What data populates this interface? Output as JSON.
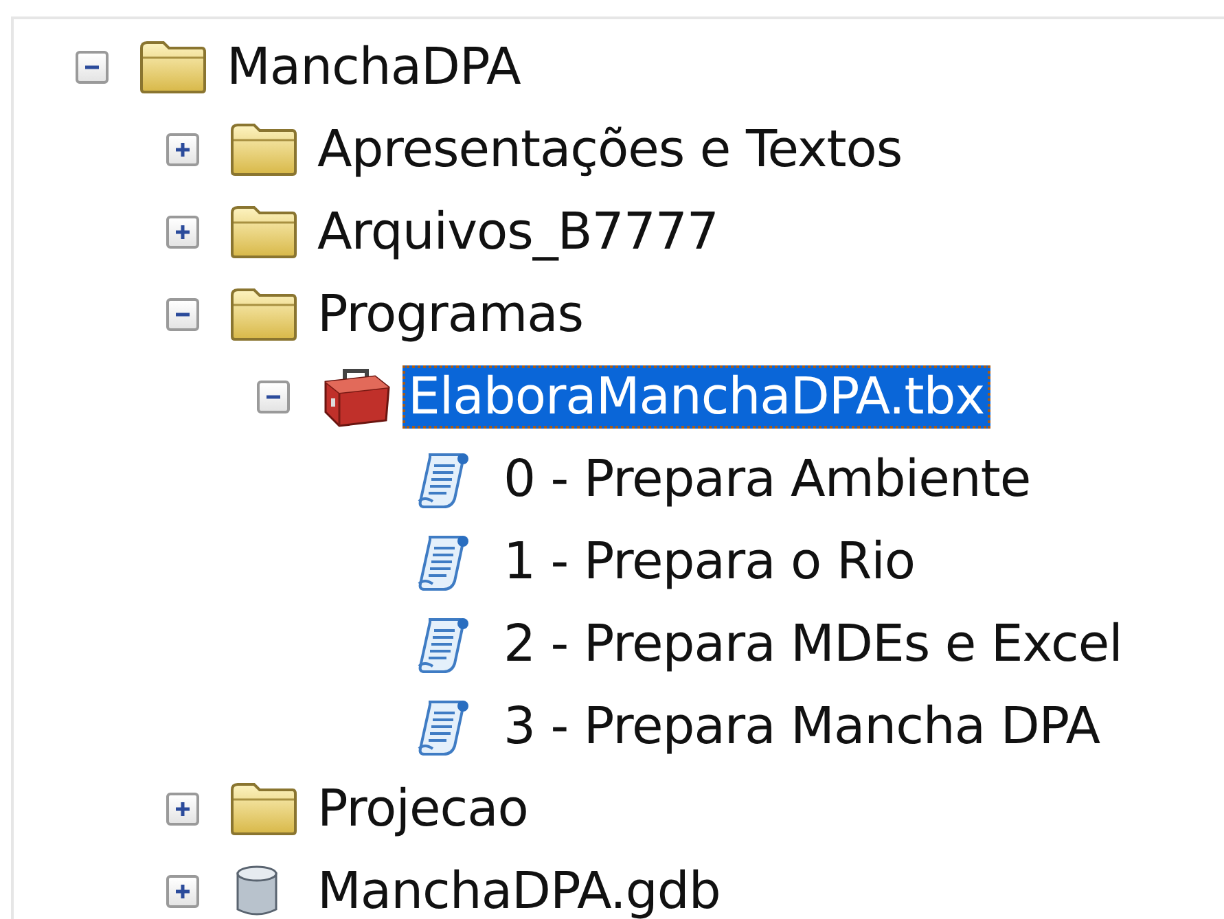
{
  "tree": [
    {
      "label": "ManchaDPA",
      "kind": "folder",
      "expanded": true,
      "selected": false,
      "children": [
        {
          "label": "Apresentações e Textos",
          "kind": "folder",
          "expanded": false,
          "selected": false
        },
        {
          "label": "Arquivos_B7777",
          "kind": "folder",
          "expanded": false,
          "selected": false
        },
        {
          "label": "Programas",
          "kind": "folder",
          "expanded": true,
          "selected": false,
          "children": [
            {
              "label": "ElaboraManchaDPA.tbx",
              "kind": "toolbox",
              "expanded": true,
              "selected": true,
              "children": [
                {
                  "label": "0 - Prepara Ambiente",
                  "kind": "script",
                  "selected": false
                },
                {
                  "label": "1 - Prepara o Rio",
                  "kind": "script",
                  "selected": false
                },
                {
                  "label": "2 - Prepara MDEs e Excel",
                  "kind": "script",
                  "selected": false
                },
                {
                  "label": "3 - Prepara Mancha DPA",
                  "kind": "script",
                  "selected": false
                }
              ]
            }
          ]
        },
        {
          "label": "Projecao",
          "kind": "folder",
          "expanded": false,
          "selected": false
        },
        {
          "label": "ManchaDPA.gdb",
          "kind": "geodatabase",
          "expanded": false,
          "selected": false
        }
      ]
    }
  ]
}
